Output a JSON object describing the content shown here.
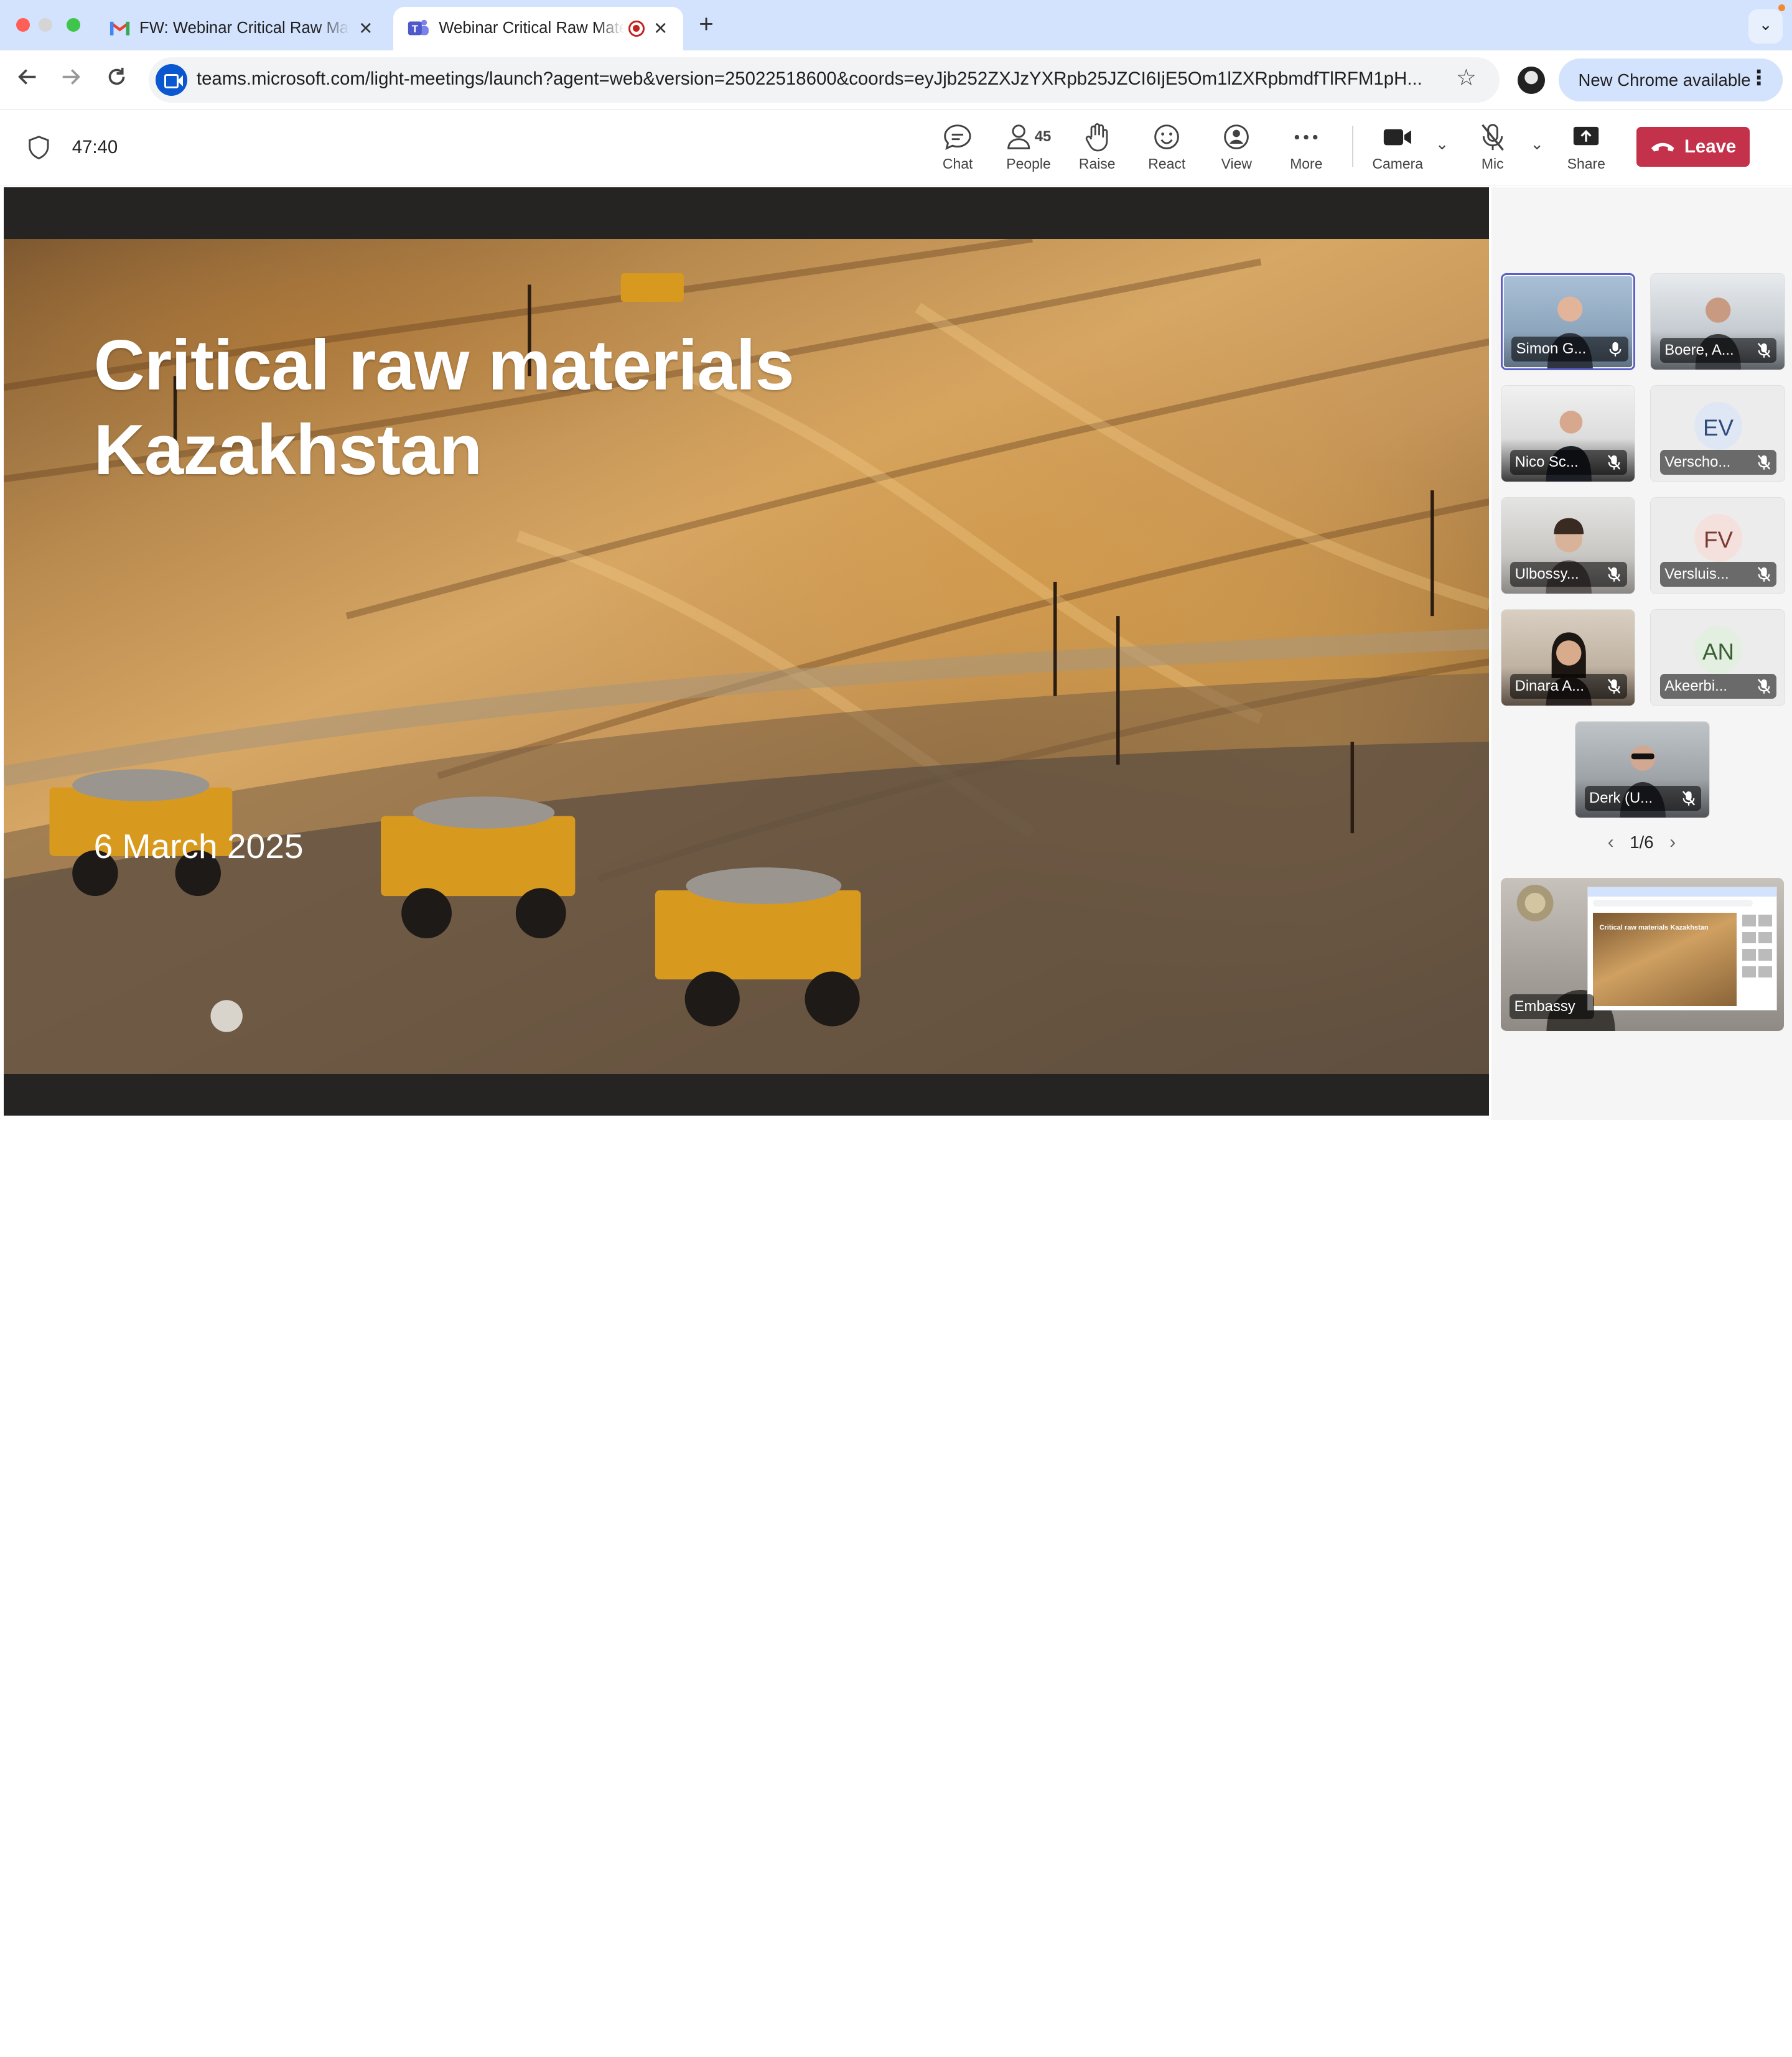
{
  "browser": {
    "tabs": [
      {
        "title": "FW: Webinar Critical Raw Materials",
        "icon": "gmail-icon",
        "active": false
      },
      {
        "title": "Webinar Critical Raw Materials",
        "icon": "teams-icon",
        "active": true,
        "recording": true
      }
    ],
    "url": "teams.microsoft.com/light-meetings/launch?agent=web&version=25022518600&coords=eyJjb252ZXJzYXRpb25JZCI6IjE5Om1lZXRpbmdfTlRFM1pH...",
    "update_label": "New Chrome available"
  },
  "meeting": {
    "duration": "47:40",
    "people_count": "45",
    "controls": {
      "chat": "Chat",
      "people": "People",
      "raise": "Raise",
      "react": "React",
      "view": "View",
      "more": "More",
      "camera": "Camera",
      "mic": "Mic",
      "share": "Share",
      "leave": "Leave"
    }
  },
  "slide": {
    "title_line1": "Critical raw materials",
    "title_line2": "Kazakhstan",
    "date": "6 March 2025"
  },
  "participants": [
    {
      "name": "Simon G...",
      "type": "video",
      "active": true,
      "muted": false
    },
    {
      "name": "Boere, A...",
      "type": "video",
      "muted": true
    },
    {
      "name": "Nico Sc...",
      "type": "video",
      "muted": true
    },
    {
      "name": "Verscho...",
      "type": "initials",
      "initials": "EV",
      "muted": true
    },
    {
      "name": "Ulbossy...",
      "type": "video",
      "muted": true
    },
    {
      "name": "Versluis...",
      "type": "initials",
      "initials": "FV",
      "muted": true
    },
    {
      "name": "Dinara A...",
      "type": "video",
      "muted": true
    },
    {
      "name": "Akeerbi...",
      "type": "initials",
      "initials": "AN",
      "muted": true
    },
    {
      "name": "Derk (U...",
      "type": "video",
      "muted": true
    }
  ],
  "pager": {
    "label": "1/6"
  },
  "screen_share": {
    "name": "Embassy",
    "mini_slide_title": "Critical raw materials Kazakhstan"
  },
  "colors": {
    "leave_button": "#c4314b",
    "active_speaker_border": "#5b5fc7",
    "tab_strip": "#d3e3fd"
  }
}
